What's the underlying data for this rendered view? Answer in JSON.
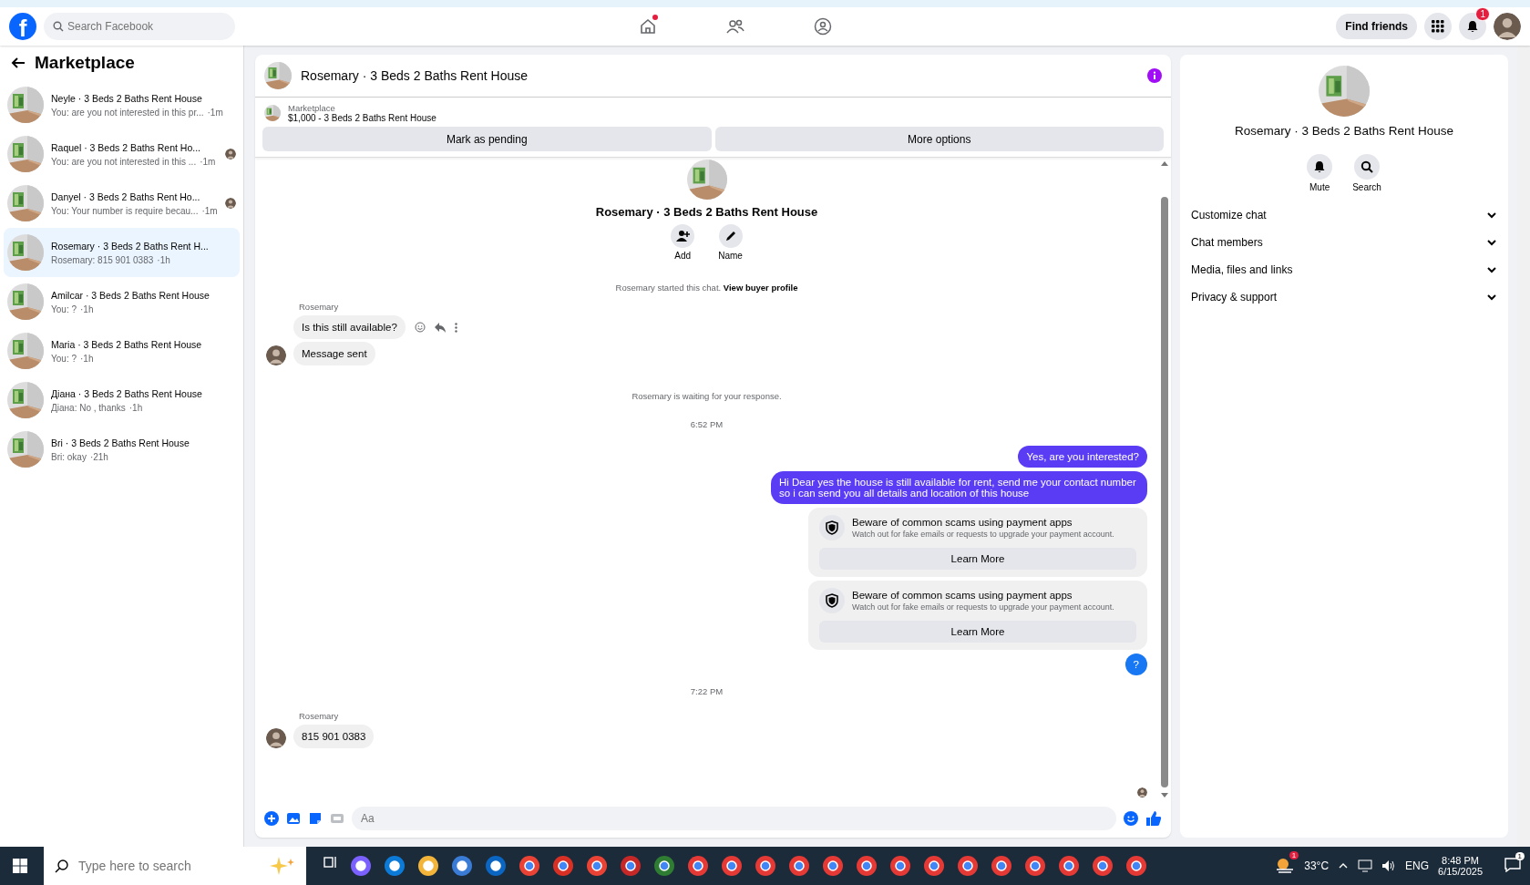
{
  "topbar": {
    "logo": "f",
    "search_placeholder": "Search Facebook",
    "home_dot": true,
    "find_friends": "Find friends",
    "notification_count": "1"
  },
  "sidebar": {
    "title": "Marketplace",
    "chats": [
      {
        "name": "Neyle · 3 Beds 2 Baths Rent House",
        "preview": "You: are you not interested in this pr...",
        "time": "·1m",
        "selected": false,
        "read_receipt": false
      },
      {
        "name": "Raquel · 3 Beds 2 Baths Rent Ho...",
        "preview": "You: are you not interested in this ...",
        "time": "·1m",
        "selected": false,
        "read_receipt": true
      },
      {
        "name": "Danyel · 3 Beds 2 Baths Rent Ho...",
        "preview": "You: Your number is require becau...",
        "time": "·1m",
        "selected": false,
        "read_receipt": true
      },
      {
        "name": "Rosemary · 3 Beds 2 Baths Rent H...",
        "preview": "Rosemary: 815 901 0383",
        "time": "·1h",
        "selected": true,
        "read_receipt": false
      },
      {
        "name": "Amilcar · 3 Beds 2 Baths Rent House",
        "preview": "You: ?",
        "time": "·1h",
        "selected": false,
        "read_receipt": false
      },
      {
        "name": "Maria · 3 Beds 2 Baths Rent House",
        "preview": "You: ?",
        "time": "·1h",
        "selected": false,
        "read_receipt": false
      },
      {
        "name": "Діана · 3 Beds 2 Baths Rent House",
        "preview": "Діана: No , thanks",
        "time": "·1h",
        "selected": false,
        "read_receipt": false
      },
      {
        "name": "Bri · 3 Beds 2 Baths Rent House",
        "preview": "Bri: okay",
        "time": "·21h",
        "selected": false,
        "read_receipt": false
      }
    ]
  },
  "chat": {
    "title": "Rosemary · 3 Beds 2 Baths Rent House",
    "listing": {
      "label": "Marketplace",
      "title": "$1,000 - 3 Beds 2 Baths Rent House"
    },
    "buttons": [
      "Mark as pending",
      "More options"
    ],
    "intro": {
      "name": "Rosemary · 3 Beds 2 Baths Rent House",
      "actions": [
        {
          "kind": "add",
          "label": "Add"
        },
        {
          "kind": "name",
          "label": "Name"
        }
      ]
    },
    "messages": [
      {
        "kind": "system",
        "text": "Rosemary started this chat.",
        "link": "View buyer profile"
      },
      {
        "kind": "incoming",
        "sender": "Rosemary",
        "bubbles": [
          "Is this still available?",
          "Message sent"
        ]
      },
      {
        "kind": "system",
        "text": "Rosemary is waiting for your response."
      },
      {
        "kind": "time",
        "text": "6:52 PM"
      },
      {
        "kind": "outgoing",
        "text": "Yes, are you interested?",
        "color": "#5b3cf5"
      },
      {
        "kind": "outgoing",
        "text": "Hi Dear yes the house is still available for rent, send me your contact number so i can send you all details and location of this house",
        "color": "#5b3cf5"
      },
      {
        "kind": "warning",
        "title": "Beware of common scams using payment apps",
        "body": "Watch out for fake emails or requests to upgrade your payment account.",
        "button": "Learn More"
      },
      {
        "kind": "warning",
        "title": "Beware of common scams using payment apps",
        "body": "Watch out for fake emails or requests to upgrade your payment account.",
        "button": "Learn More"
      },
      {
        "kind": "outgoing",
        "text": "?",
        "color": "#1877f2"
      },
      {
        "kind": "time",
        "text": "7:22 PM"
      },
      {
        "kind": "incoming",
        "sender": "Rosemary",
        "bubbles": [
          "815 901 0383"
        ]
      }
    ],
    "composer": {
      "placeholder": "Aa"
    }
  },
  "details": {
    "name": "Rosemary · 3 Beds 2 Baths Rent House",
    "actions": [
      {
        "kind": "mute",
        "label": "Mute"
      },
      {
        "kind": "search",
        "label": "Search"
      }
    ],
    "sections": [
      {
        "label": "Customize chat",
        "expanded": false
      },
      {
        "label": "Chat members",
        "expanded": false
      },
      {
        "label": "Media, files and links",
        "expanded": false
      },
      {
        "label": "Privacy & support",
        "expanded": false
      }
    ]
  },
  "taskbar": {
    "search_placeholder": "Type here to search",
    "weather_badge": "1",
    "temperature": "33°C",
    "language": "ENG",
    "time": "8:48 PM",
    "date": "6/15/2025",
    "notification_count": "1"
  }
}
